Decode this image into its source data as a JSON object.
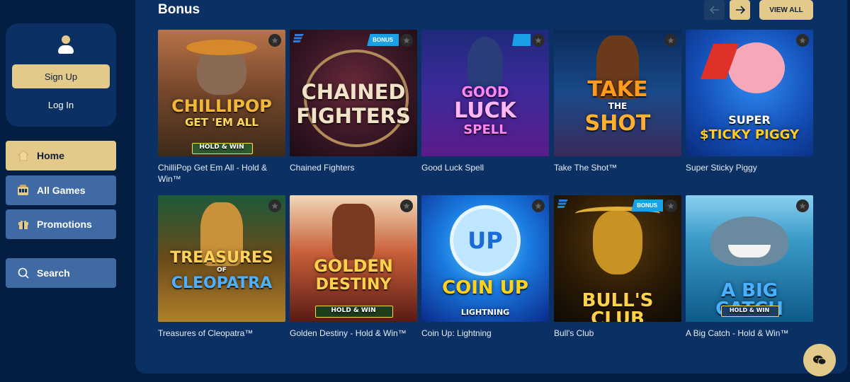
{
  "sidebar": {
    "auth": {
      "signup_label": "Sign Up",
      "login_label": "Log In"
    },
    "nav": [
      {
        "label": "Home",
        "icon": "home-icon",
        "active": true
      },
      {
        "label": "All Games",
        "icon": "slot-machine-icon",
        "active": false
      },
      {
        "label": "Promotions",
        "icon": "gift-icon",
        "active": false
      },
      {
        "label": "Search",
        "icon": "search-icon",
        "active": false
      }
    ]
  },
  "section": {
    "title": "Bonus",
    "view_all_label": "VIEW ALL",
    "prev_icon": "arrow-left-icon",
    "next_icon": "arrow-right-icon"
  },
  "badge": {
    "bonus_label": "BONUS"
  },
  "games": [
    {
      "name": "ChilliPop Get Em All - Hold & Win™",
      "logo": [
        "CHILLIPOP",
        "GET 'EM ALL",
        "HOLD & WIN"
      ]
    },
    {
      "name": "Chained Fighters",
      "logo": [
        "CHAINED",
        "FIGHTERS"
      ]
    },
    {
      "name": "Good Luck Spell",
      "logo": [
        "GOOD",
        "LUCK",
        "SPELL"
      ]
    },
    {
      "name": "Take The Shot™",
      "logo": [
        "TAKE",
        "THE",
        "SHOT"
      ]
    },
    {
      "name": "Super Sticky Piggy",
      "logo": [
        "SUPER",
        "$TICKY PIGGY"
      ]
    },
    {
      "name": "Treasures of Cleopatra™",
      "logo": [
        "TREASURES",
        "OF",
        "CLEOPATRA"
      ]
    },
    {
      "name": "Golden Destiny - Hold & Win™",
      "logo": [
        "GOLDEN",
        "DESTINY",
        "HOLD & WIN"
      ]
    },
    {
      "name": "Coin Up: Lightning",
      "logo": [
        "UP",
        "COIN UP",
        "LIGHTNING"
      ]
    },
    {
      "name": "Bull's Club",
      "logo": [
        "BULL'S CLUB"
      ]
    },
    {
      "name": "A Big Catch - Hold & Win™",
      "logo": [
        "A BIG CATCH",
        "HOLD & WIN"
      ]
    }
  ],
  "colors": {
    "background": "#031e42",
    "panel": "#0b3164",
    "accent": "#e3c98a",
    "nav_item": "#3f6aa3",
    "bonus_badge": "#1aa0e6"
  },
  "chat": {
    "icon": "chat-bubbles-icon"
  }
}
